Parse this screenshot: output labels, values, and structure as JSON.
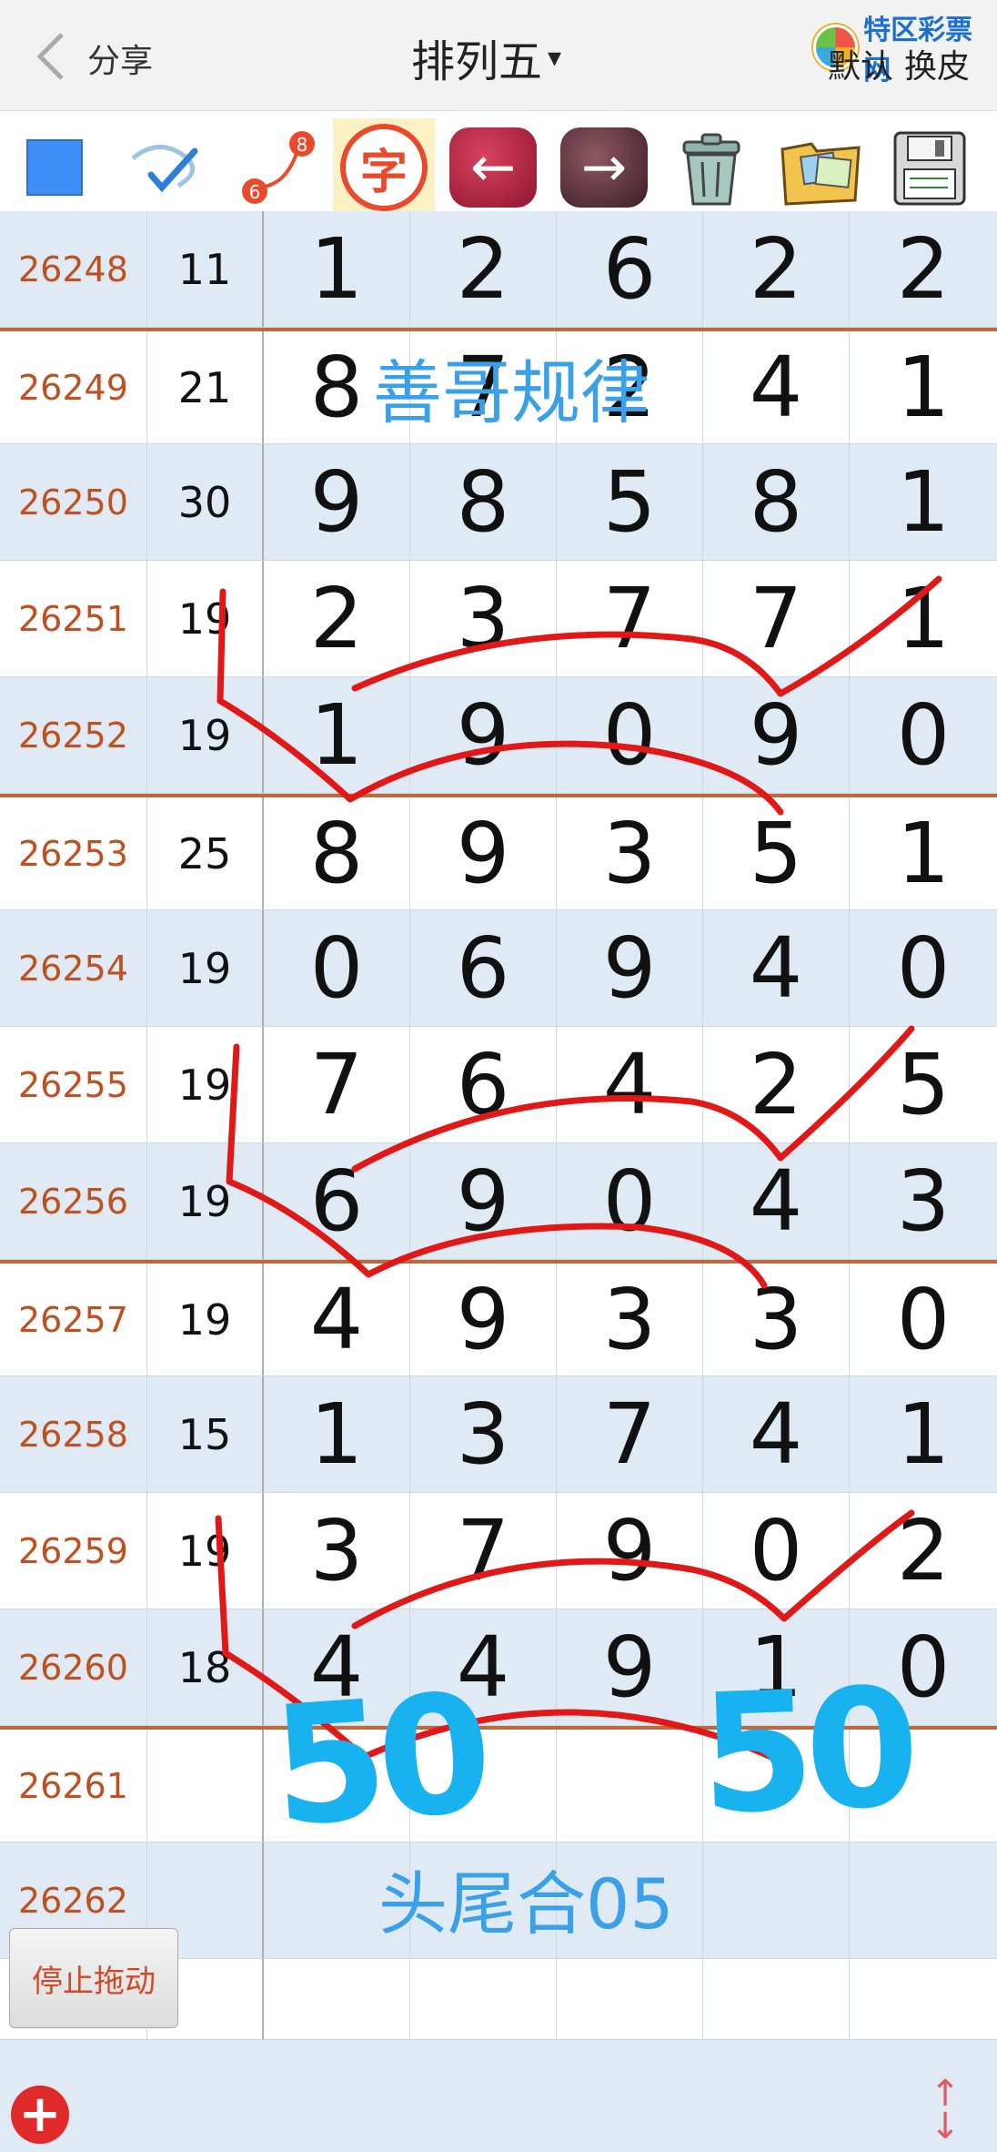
{
  "header": {
    "share_label": "分享",
    "title": "排列五",
    "title_caret": "▾",
    "logo_text": "特区彩票网",
    "default_label": "默认",
    "skin_label": "换皮"
  },
  "toolbar": {
    "tools": [
      {
        "name": "color-square"
      },
      {
        "name": "pen-check"
      },
      {
        "name": "connect-68",
        "badge_a": "6",
        "badge_b": "8"
      },
      {
        "name": "text",
        "label": "字"
      },
      {
        "name": "undo",
        "label": "←"
      },
      {
        "name": "redo",
        "label": "→"
      },
      {
        "name": "trash"
      },
      {
        "name": "folder"
      },
      {
        "name": "save"
      }
    ]
  },
  "rows": [
    {
      "issue": "26248",
      "sum": "11",
      "d": [
        "1",
        "2",
        "6",
        "2",
        "2"
      ],
      "alt": true
    },
    {
      "issue": "26249",
      "sum": "21",
      "d": [
        "8",
        "7",
        "2",
        "4",
        "1"
      ],
      "alt": false
    },
    {
      "issue": "26250",
      "sum": "30",
      "d": [
        "9",
        "8",
        "5",
        "8",
        "1"
      ],
      "alt": true
    },
    {
      "issue": "26251",
      "sum": "19",
      "d": [
        "2",
        "3",
        "7",
        "7",
        "1"
      ],
      "alt": false
    },
    {
      "issue": "26252",
      "sum": "19",
      "d": [
        "1",
        "9",
        "0",
        "9",
        "0"
      ],
      "alt": true
    },
    {
      "issue": "26253",
      "sum": "25",
      "d": [
        "8",
        "9",
        "3",
        "5",
        "1"
      ],
      "alt": false
    },
    {
      "issue": "26254",
      "sum": "19",
      "d": [
        "0",
        "6",
        "9",
        "4",
        "0"
      ],
      "alt": true
    },
    {
      "issue": "26255",
      "sum": "19",
      "d": [
        "7",
        "6",
        "4",
        "2",
        "5"
      ],
      "alt": false
    },
    {
      "issue": "26256",
      "sum": "19",
      "d": [
        "6",
        "9",
        "0",
        "4",
        "3"
      ],
      "alt": true
    },
    {
      "issue": "26257",
      "sum": "19",
      "d": [
        "4",
        "9",
        "3",
        "3",
        "0"
      ],
      "alt": false
    },
    {
      "issue": "26258",
      "sum": "15",
      "d": [
        "1",
        "3",
        "7",
        "4",
        "1"
      ],
      "alt": true
    },
    {
      "issue": "26259",
      "sum": "19",
      "d": [
        "3",
        "7",
        "9",
        "0",
        "2"
      ],
      "alt": false
    },
    {
      "issue": "26260",
      "sum": "18",
      "d": [
        "4",
        "4",
        "9",
        "1",
        "0"
      ],
      "alt": true
    },
    {
      "issue": "26261",
      "sum": "",
      "d": [
        "",
        "",
        "",
        "",
        ""
      ],
      "alt": false
    },
    {
      "issue": "26262",
      "sum": "",
      "d": [
        "",
        "",
        "",
        "",
        ""
      ],
      "alt": true
    },
    {
      "issue": "",
      "sum": "",
      "d": [
        "",
        "",
        "",
        "",
        ""
      ],
      "alt": false
    }
  ],
  "annotations": {
    "top_text": "善哥规律",
    "bottom_text": "头尾合05",
    "big_a": "50",
    "big_b": "50",
    "stroke_color": "#e01818",
    "text_color": "#3aa0e8",
    "number_color": "#19b2f0"
  },
  "buttons": {
    "stop_drag": "停止拖动"
  },
  "colors": {
    "header_bg": "#f2f2f2",
    "row_alt_bg": "#dfeaf4",
    "issue_color": "#c05020",
    "separator": "#c0673c"
  }
}
